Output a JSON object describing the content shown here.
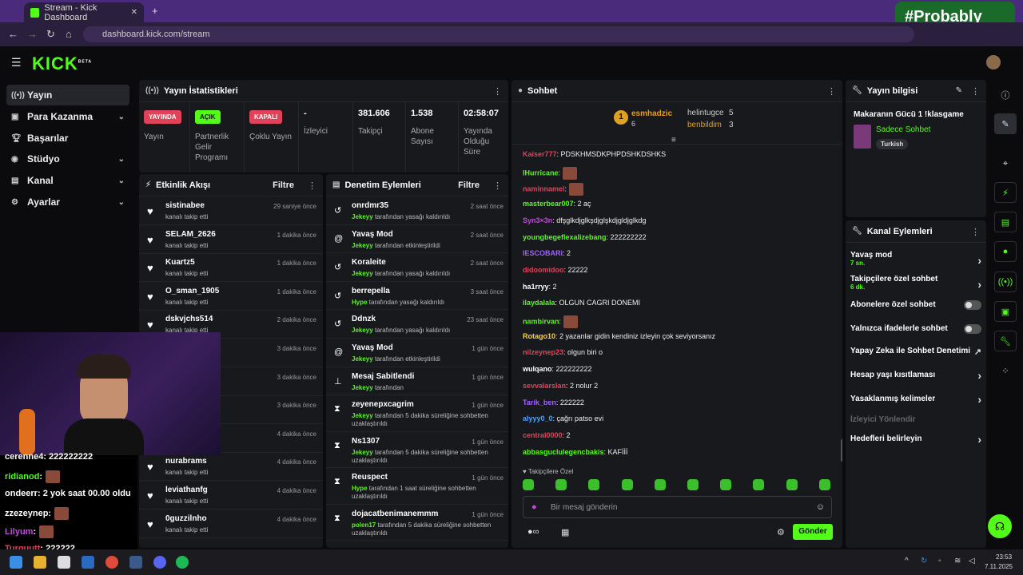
{
  "browser": {
    "tab_title": "Stream - Kick Dashboard",
    "url": "dashboard.kick.com/stream",
    "watermark": "#Probably"
  },
  "app": {
    "logo": "KICK",
    "beta": "BETA"
  },
  "sidebar": {
    "items": [
      {
        "label": "Yayın",
        "icon": "broadcast-icon"
      },
      {
        "label": "Para Kazanma",
        "icon": "money-icon"
      },
      {
        "label": "Başarılar",
        "icon": "trophy-icon"
      },
      {
        "label": "Stüdyo",
        "icon": "studio-icon"
      },
      {
        "label": "Kanal",
        "icon": "channel-icon"
      },
      {
        "label": "Ayarlar",
        "icon": "gear-icon"
      }
    ]
  },
  "stats": {
    "title": "Yayın İstatistikleri",
    "yayin_badge": "YAYINDA",
    "yayin_label": "Yayın",
    "partner_badge": "AÇIK",
    "partner_label": "Partnerlik Gelir Programı",
    "coklu_badge": "KAPALI",
    "coklu_label": "Çoklu Yayın",
    "izleyici_value": "-",
    "izleyici_label": "İzleyici",
    "takipci_value": "381.606",
    "takipci_label": "Takipçi",
    "abone_value": "1.538",
    "abone_label": "Abone Sayısı",
    "sure_value": "02:58:07",
    "sure_label": "Yayında Olduğu Süre"
  },
  "activity": {
    "title": "Etkinlik Akışı",
    "filter": "Filtre",
    "rows": [
      {
        "name": "sistinabee",
        "sub": "kanalı takip etti",
        "time": "29 saniye önce"
      },
      {
        "name": "SELAM_2626",
        "sub": "kanalı takip etti",
        "time": "1 dakika önce"
      },
      {
        "name": "Kuartz5",
        "sub": "kanalı takip etti",
        "time": "1 dakika önce"
      },
      {
        "name": "O_sman_1905",
        "sub": "kanalı takip etti",
        "time": "1 dakika önce"
      },
      {
        "name": "dskvjchs514",
        "sub": "kanalı takip etti",
        "time": "2 dakika önce"
      },
      {
        "name": "",
        "sub": "",
        "time": "3 dakika önce"
      },
      {
        "name": "",
        "sub": "",
        "time": "3 dakika önce"
      },
      {
        "name": "",
        "sub": "",
        "time": "3 dakika önce"
      },
      {
        "name": "",
        "sub": "",
        "time": "4 dakika önce"
      },
      {
        "name": "nurabrams",
        "sub": "kanalı takip etti",
        "time": "4 dakika önce"
      },
      {
        "name": "leviathanfg",
        "sub": "kanalı takip etti",
        "time": "4 dakika önce"
      },
      {
        "name": "0guzzilnho",
        "sub": "kanalı takip etti",
        "time": "4 dakika önce"
      }
    ]
  },
  "moderation": {
    "title": "Denetim Eylemleri",
    "filter": "Filtre",
    "rows": [
      {
        "name": "onrdmr35",
        "by": "Jekeyy",
        "sub": "tarafından yasağı kaldırıldı",
        "time": "2 saat önce",
        "icon": "undo-icon"
      },
      {
        "name": "Yavaş Mod",
        "by": "Jekeyy",
        "sub": "tarafından etkinleştirildi",
        "time": "2 saat önce",
        "icon": "snail-icon"
      },
      {
        "name": "Koraleite",
        "by": "Jekeyy",
        "sub": "tarafından yasağı kaldırıldı",
        "time": "2 saat önce",
        "icon": "undo-icon"
      },
      {
        "name": "berrepella",
        "by": "Hype",
        "sub": "tarafından yasağı kaldırıldı",
        "time": "3 saat önce",
        "icon": "undo-icon"
      },
      {
        "name": "Ddnzk",
        "by": "Jekeyy",
        "sub": "tarafından yasağı kaldırıldı",
        "time": "23 saat önce",
        "icon": "undo-icon"
      },
      {
        "name": "Yavaş Mod",
        "by": "Jekeyy",
        "sub": "tarafından etkinleştirildi",
        "time": "1 gün önce",
        "icon": "snail-icon"
      },
      {
        "name": "Mesaj Sabitlendi",
        "by": "Jekeyy",
        "sub": "tarafından",
        "time": "1 gün önce",
        "icon": "pin-icon"
      },
      {
        "name": "zeyenepxcagrim",
        "by": "Jekeyy",
        "sub": "tarafından 5 dakika süreliğine sohbetten uzaklaştırıldı",
        "time": "1 gün önce",
        "icon": "hourglass-icon"
      },
      {
        "name": "Ns1307",
        "by": "Jekeyy",
        "sub": "tarafından 5 dakika süreliğine sohbetten uzaklaştırıldı",
        "time": "1 gün önce",
        "icon": "hourglass-icon"
      },
      {
        "name": "Reuspect",
        "by": "Hype",
        "sub": "tarafından 1 saat süreliğine sohbetten uzaklaştırıldı",
        "time": "1 gün önce",
        "icon": "hourglass-icon"
      },
      {
        "name": "dojacatbenimanemmm",
        "by": "polen17",
        "sub": "tarafından 5 dakika süreliğine sohbetten uzaklaştırıldı",
        "time": "1 gün önce",
        "icon": "hourglass-icon"
      }
    ]
  },
  "chat": {
    "title": "Sohbet",
    "top": [
      {
        "name": "esmhadzic",
        "count": "6",
        "rank": "1"
      },
      {
        "name": "helintugce",
        "count": "5"
      },
      {
        "name": "benbildim",
        "count": "3"
      }
    ],
    "messages": [
      {
        "user": "Kaiser777",
        "color": "#e0425a",
        "text": ": PDSKHMSDKPHPDSHKDSHKS"
      },
      {
        "user": "lHurricane",
        "color": "#53fc18",
        "text": ":"
      },
      {
        "user": "naminnamei",
        "color": "#e0425a",
        "text": ":"
      },
      {
        "user": "masterbear007",
        "color": "#53fc18",
        "text": ": 2 aç"
      },
      {
        "user": "Syn3×3n",
        "color": "#c24ae0",
        "text": ": dfşglkdjglkşdjglşkdjgldjglkdg"
      },
      {
        "user": "youngbegeflexalizebang",
        "color": "#53fc18",
        "text": ": 222222222"
      },
      {
        "user": "IESCOBARi",
        "color": "#a060ff",
        "text": ": 2"
      },
      {
        "user": "didoomidoo",
        "color": "#e0425a",
        "text": ": 22222"
      },
      {
        "user": "ha1rryy",
        "color": "#ffffff",
        "text": ": 2"
      },
      {
        "user": "ilaydalala",
        "color": "#53fc18",
        "text": ": OLGUN CAGRI DONEMI"
      },
      {
        "user": "nambirvan",
        "color": "#53fc18",
        "text": ":"
      },
      {
        "user": "Rotago10",
        "color": "#ffd23a",
        "text": ": 2 yazanlar gidin kendiniz izleyin çok seviyorsanız"
      },
      {
        "user": "nilzeynep23",
        "color": "#e0425a",
        "text": ": olgun biri o"
      },
      {
        "user": "wulqano",
        "color": "#ffffff",
        "text": ": 222222222"
      },
      {
        "user": "sevvalarslan",
        "color": "#e0425a",
        "text": ": 2 nolur 2"
      },
      {
        "user": "Tarik_ben",
        "color": "#a060ff",
        "text": ": 222222"
      },
      {
        "user": "alyyy0_0",
        "color": "#4aa3ff",
        "text": ": çağrı patso evi"
      },
      {
        "user": "central0000",
        "color": "#e0425a",
        "text": ": 2"
      },
      {
        "user": "abbasguclulegencbakis",
        "color": "#53fc18",
        "text": ": KAFİİİ"
      }
    ],
    "followers_only": "Takipçilere Özel",
    "input_placeholder": "Bir mesaj gönderin",
    "send": "Gönder"
  },
  "stream_info": {
    "title": "Yayın bilgisi",
    "stream_title": "Makaranın Gücü 1 !klasgame",
    "category": "Sadece Sohbet",
    "language": "Turkish"
  },
  "channel_actions": {
    "title": "Kanal Eylemleri",
    "rows": [
      {
        "label": "Yavaş mod",
        "sub": "7 sn.",
        "control": "arrow"
      },
      {
        "label": "Takipçilere özel sohbet",
        "sub": "6 dk.",
        "control": "arrow"
      },
      {
        "label": "Abonelere özel sohbet",
        "sub": "",
        "control": "toggle"
      },
      {
        "label": "Yalnızca ifadelerle sohbet",
        "sub": "",
        "control": "toggle"
      },
      {
        "label": "Yapay Zeka ile Sohbet Denetimi",
        "sub": "",
        "control": "external"
      },
      {
        "label": "Hesap yaşı kısıtlaması",
        "sub": "",
        "control": "arrow"
      },
      {
        "label": "Yasaklanmış kelimeler",
        "sub": "",
        "control": "arrow"
      },
      {
        "label": "İzleyici Yönlendir",
        "sub": "",
        "control": "none"
      },
      {
        "label": "Hedefleri belirleyin",
        "sub": "",
        "control": "arrow"
      }
    ]
  },
  "overlay_chat": [
    {
      "user": "cerenne4",
      "text": ": 222222222",
      "color": "#ffffff"
    },
    {
      "user": "ridianod",
      "text": ":",
      "color": "#53fc18"
    },
    {
      "user": "ondeerr",
      "text": ": 2 yok saat 00.00 oldu",
      "color": "#ffffff"
    },
    {
      "user": "zzezeynep",
      "text": ":",
      "color": "#ffffff"
    },
    {
      "user": "Lilyum",
      "text": ":",
      "color": "#c24ae0"
    },
    {
      "user": "Turguutt",
      "text": ": 222222",
      "color": "#e0425a"
    }
  ],
  "taskbar": {
    "time": "23:53",
    "date": "7.11.2025"
  },
  "colors": {
    "accent": "#53fc18",
    "live": "#e0425a"
  }
}
